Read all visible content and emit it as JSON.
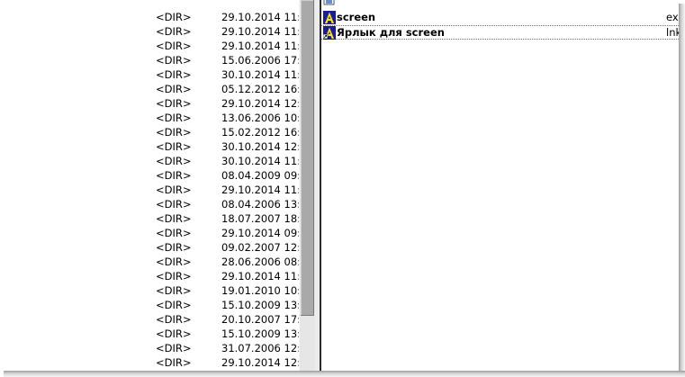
{
  "left_panel": {
    "rows": [
      {
        "type": "<DIR>",
        "date": "29.10.2014 11:"
      },
      {
        "type": "<DIR>",
        "date": "29.10.2014 11:"
      },
      {
        "type": "<DIR>",
        "date": "29.10.2014 11:"
      },
      {
        "type": "<DIR>",
        "date": "15.06.2006 17:"
      },
      {
        "type": "<DIR>",
        "date": "30.10.2014 11:"
      },
      {
        "type": "<DIR>",
        "date": "05.12.2012 16:"
      },
      {
        "type": "<DIR>",
        "date": "29.10.2014 12:"
      },
      {
        "type": "<DIR>",
        "date": "13.06.2006 10:"
      },
      {
        "type": "<DIR>",
        "date": "15.02.2012 16:"
      },
      {
        "type": "<DIR>",
        "date": "30.10.2014 12:"
      },
      {
        "type": "<DIR>",
        "date": "30.10.2014 11:"
      },
      {
        "type": "<DIR>",
        "date": "08.04.2009 09:"
      },
      {
        "type": "<DIR>",
        "date": "29.10.2014 11:"
      },
      {
        "type": "<DIR>",
        "date": "08.04.2006 13:"
      },
      {
        "type": "<DIR>",
        "date": "18.07.2007 18:"
      },
      {
        "type": "<DIR>",
        "date": "29.10.2014 09:"
      },
      {
        "type": "<DIR>",
        "date": "09.02.2007 12:"
      },
      {
        "type": "<DIR>",
        "date": "28.06.2006 08:"
      },
      {
        "type": "<DIR>",
        "date": "29.10.2014 11:"
      },
      {
        "type": "<DIR>",
        "date": "19.01.2010 10:"
      },
      {
        "type": "<DIR>",
        "date": "15.10.2009 13:"
      },
      {
        "type": "<DIR>",
        "date": "20.10.2007 17:"
      },
      {
        "type": "<DIR>",
        "date": "15.10.2009 13:"
      },
      {
        "type": "<DIR>",
        "date": "31.07.2006 12:"
      },
      {
        "type": "<DIR>",
        "date": "29.10.2014 12:"
      }
    ]
  },
  "right_panel": {
    "files": [
      {
        "name": "screen",
        "ext": "ex",
        "icon": "screen-app-icon"
      },
      {
        "name": "Ярлык для screen",
        "ext": "lnk",
        "icon": "screen-shortcut-icon"
      }
    ]
  },
  "colors": {
    "icon_background": "#1a1aa0",
    "icon_letter": "#ffe600",
    "scroll_thumb": "#a9a9a9",
    "scroll_track": "#e6e6e6",
    "panel_border": "#2b2b2b"
  }
}
